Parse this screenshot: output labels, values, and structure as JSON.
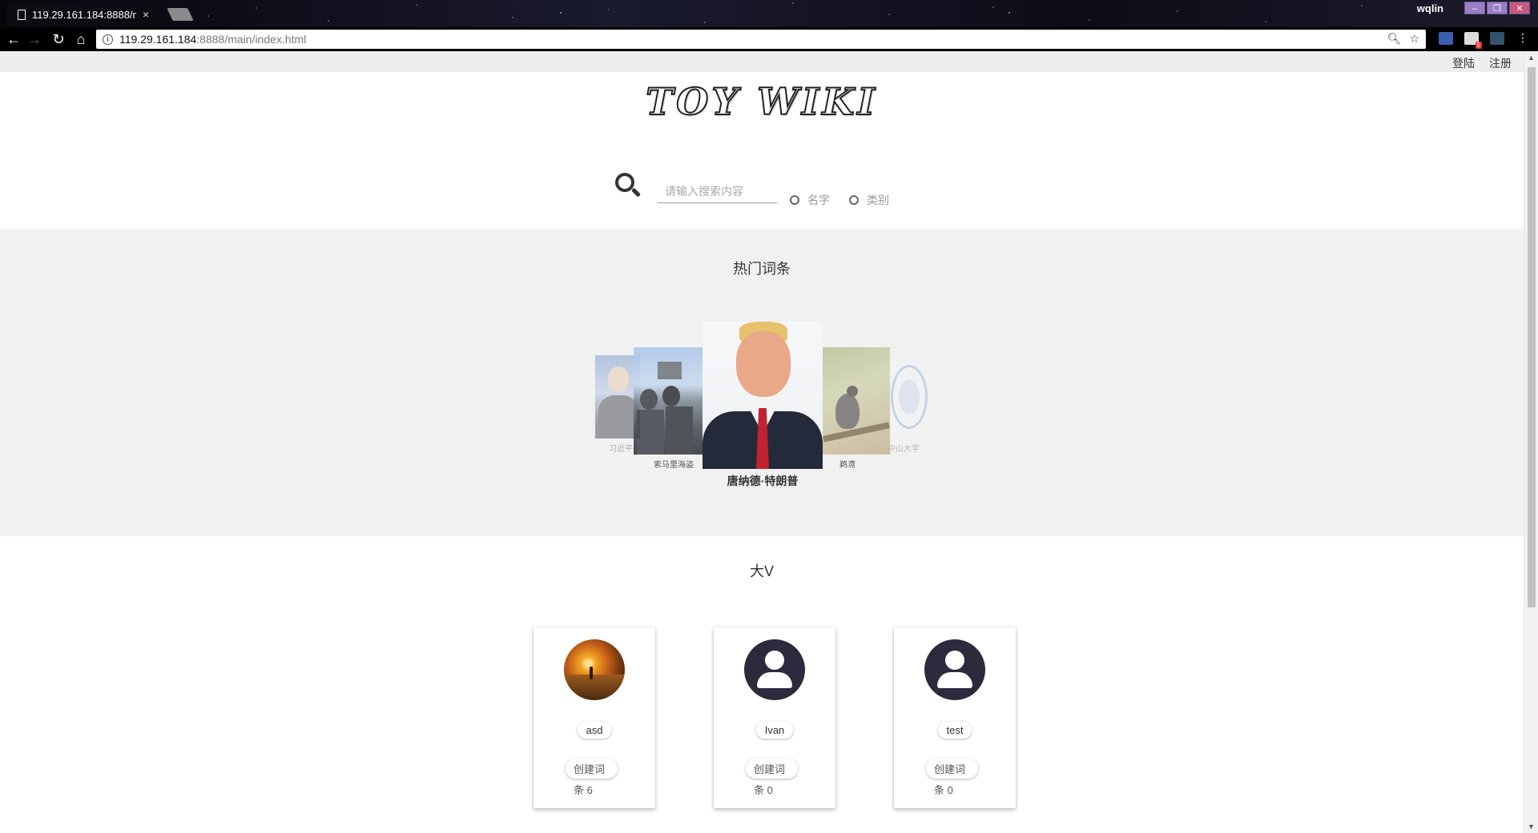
{
  "browser": {
    "tab_title": "119.29.161.184:8888/n",
    "tab_close": "×",
    "url_host": "119.29.161.184",
    "url_rest": ":8888/main/index.html",
    "user_name": "wqlin",
    "mail_badge": "5"
  },
  "header": {
    "login_label": "登陆",
    "register_label": "注册"
  },
  "logo": {
    "text": "TOY WIKI"
  },
  "search": {
    "placeholder": "请输入搜索内容",
    "value": "",
    "option_name": "名字",
    "option_category": "类别"
  },
  "hot": {
    "title": "热门词条",
    "items": [
      {
        "caption": "习近平",
        "image": "portrait-man-blue-background"
      },
      {
        "caption": "索马里海盗",
        "image": "soldiers-on-ship"
      },
      {
        "caption": "唐纳德·特朗普",
        "image": "portrait-man-red-tie"
      },
      {
        "caption": "鹈鸢",
        "image": "bird-on-branch"
      },
      {
        "caption": "中山大学",
        "image": "university-seal"
      }
    ]
  },
  "dav": {
    "title": "大V",
    "users": [
      {
        "name": "asd",
        "avatar": "sunset-photo",
        "create_label": "创建词",
        "count_label": "条 6"
      },
      {
        "name": "Ivan",
        "avatar": "default-user-icon",
        "create_label": "创建词",
        "count_label": "条 0"
      },
      {
        "name": "test",
        "avatar": "default-user-icon",
        "create_label": "创建词",
        "count_label": "条 0"
      }
    ]
  },
  "colors": {
    "section_bg": "#f1f1f1",
    "avatar_default": "#2b2b3d",
    "chrome_bg": "#000000"
  }
}
